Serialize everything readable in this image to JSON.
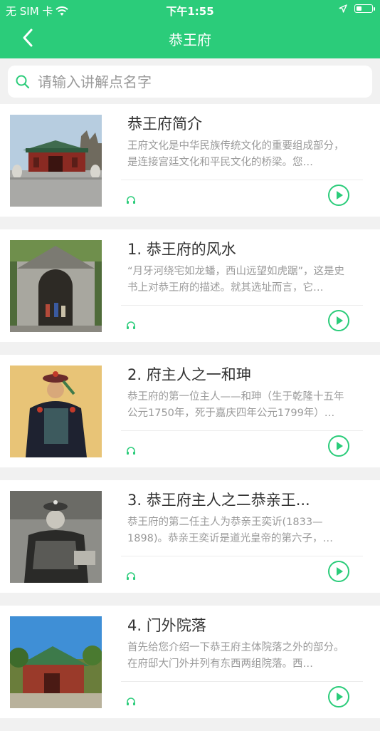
{
  "status_bar": {
    "carrier": "无 SIM 卡",
    "time": "下午1:55",
    "battery_level": 0.35
  },
  "nav": {
    "title": "恭王府",
    "back_icon": "chevron-left-icon"
  },
  "search": {
    "placeholder": "请输入讲解点名字",
    "icon": "search-icon"
  },
  "items": [
    {
      "title": "恭王府简介",
      "desc": "王府文化是中华民族传统文化的重要组成部分，是连接宫廷文化和平民文化的桥梁。您…",
      "thumb": "palace-gate"
    },
    {
      "title": "1. 恭王府的风水",
      "desc": "“月牙河绕宅如龙蟠，西山远望如虎踞”，这是史书上对恭王府的描述。就其选址而言，它…",
      "thumb": "stone-gate"
    },
    {
      "title": "2. 府主人之一和珅",
      "desc": "恭王府的第一位主人——和珅（生于乾隆十五年公元1750年，死于嘉庆四年公元1799年）…",
      "thumb": "portrait-heshen"
    },
    {
      "title": "3. 恭王府主人之二恭亲王...",
      "desc": "恭王府的第二任主人为恭亲王奕䜣(1833—1898)。恭亲王奕䜣是道光皇帝的第六子，…",
      "thumb": "photo-prince-gong"
    },
    {
      "title": "4. 门外院落",
      "desc": "首先给您介绍一下恭王府主体院落之外的部分。在府邸大门外并列有东西两组院落。西…",
      "thumb": "courtyard"
    }
  ],
  "colors": {
    "brand": "#2bcc7a",
    "background": "#f1f1f1"
  }
}
